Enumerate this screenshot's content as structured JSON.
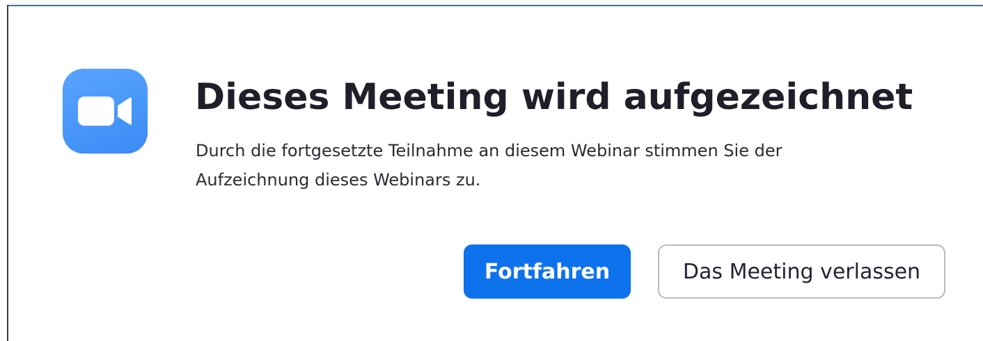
{
  "dialog": {
    "title": "Dieses Meeting wird aufgezeichnet",
    "description": "Durch die fortgesetzte Teilnahme an diesem Webinar stimmen Sie der Aufzeichnung dieses Webinars zu.",
    "icon": "video-camera-icon"
  },
  "buttons": {
    "continue_label": "Fortfahren",
    "leave_label": "Das Meeting verlassen"
  },
  "colors": {
    "primary": "#0e72ed",
    "icon_bg": "#4a98fa",
    "title_text": "#1f1f2a",
    "secondary_border": "#b8b8c0"
  }
}
